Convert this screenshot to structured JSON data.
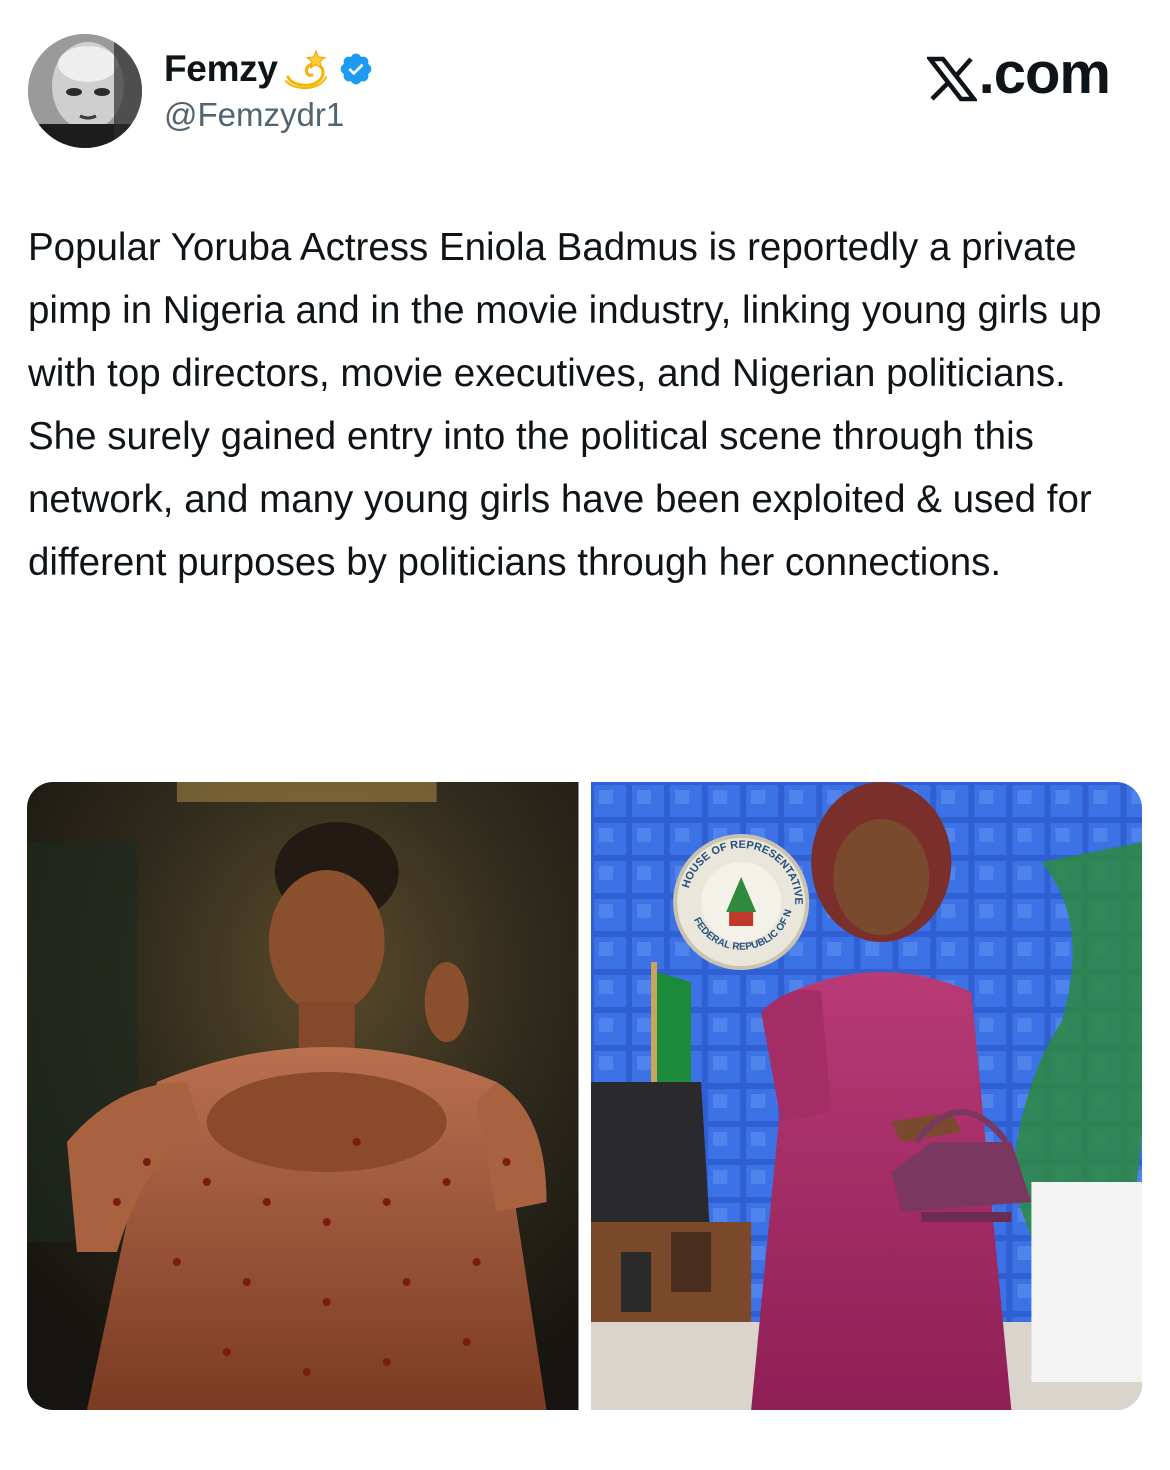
{
  "author": {
    "display_name": "Femzy",
    "name_emoji": "dizzy-icon",
    "verified": true,
    "handle": "@Femzydr1",
    "avatar": "grayscale-profile-photo"
  },
  "brand": {
    "label": ".com",
    "logo_icon": "x-logo-icon"
  },
  "tweet": {
    "text": "Popular Yoruba Actress Eniola Badmus is reportedly a private pimp in Nigeria and in the movie industry, linking young girls up with top directors, movie executives, and Nigerian politicians. She surely gained entry into the political scene through this network, and many young girls have been exploited & used for different purposes by politicians through her connections."
  },
  "media": [
    {
      "kind": "photo",
      "subject": "woman-in-beaded-brown-gown"
    },
    {
      "kind": "photo",
      "subject": "woman-in-magenta-dress-in-office"
    }
  ],
  "seal_text": {
    "top": "HOUSE OF REPRESENTATIVES",
    "bottom": "FEDERAL REPUBLIC OF NIGERIA"
  },
  "colors": {
    "text_primary": "#0f1419",
    "text_secondary": "#536471",
    "verified_blue": "#1d9bf0"
  }
}
